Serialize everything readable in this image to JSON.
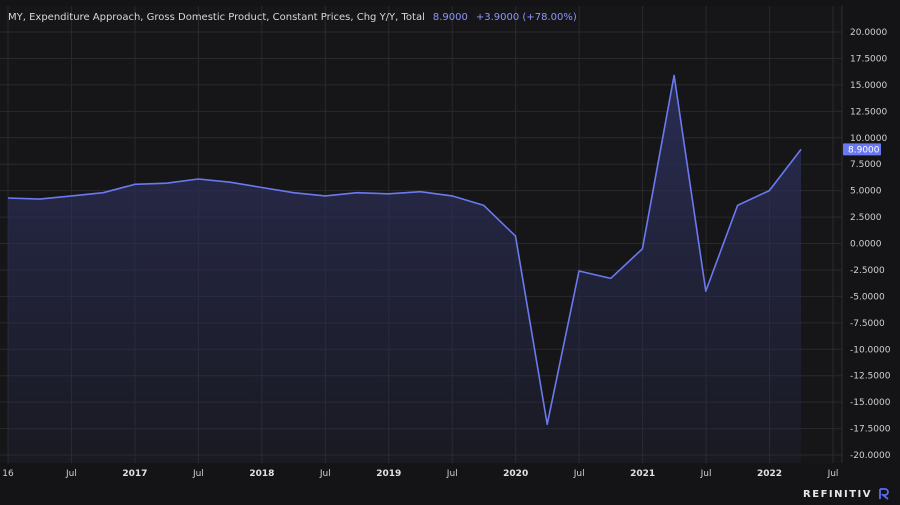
{
  "header": {
    "title": "MY, Expenditure Approach, Gross Domestic Product, Constant Prices, Chg Y/Y, Total",
    "last_value": "8.9000",
    "change": "+3.9000 (+78.00%)"
  },
  "brand": {
    "name": "REFINITIV"
  },
  "colors": {
    "line": "#6b79f0",
    "fill": "#2a2d55",
    "tag": "#6b79f0",
    "grid": "#2a2a2e"
  },
  "chart_data": {
    "type": "area",
    "title": "MY, Expenditure Approach, Gross Domestic Product, Constant Prices, Chg Y/Y, Total",
    "x": [
      "2016-04",
      "2016-07",
      "2016-10",
      "2017-01",
      "2017-04",
      "2017-07",
      "2017-10",
      "2018-01",
      "2018-04",
      "2018-07",
      "2018-10",
      "2019-01",
      "2019-04",
      "2019-07",
      "2019-10",
      "2020-01",
      "2020-04",
      "2020-07",
      "2020-10",
      "2021-01",
      "2021-04",
      "2021-07",
      "2021-10",
      "2022-01",
      "2022-04"
    ],
    "series": [
      {
        "values": [
          4.3,
          4.2,
          4.5,
          4.8,
          5.6,
          5.7,
          6.1,
          5.8,
          5.3,
          4.8,
          4.5,
          4.8,
          4.7,
          4.9,
          4.5,
          3.6,
          0.7,
          -17.1,
          -2.6,
          -3.3,
          -0.5,
          15.9,
          -4.5,
          3.6,
          5.0,
          8.9
        ]
      }
    ],
    "last_label": "8.9000",
    "ylim": [
      -20,
      22
    ],
    "yticks": [
      "20.0000",
      "17.5000",
      "15.0000",
      "12.5000",
      "10.0000",
      "7.5000",
      "5.0000",
      "2.5000",
      "0.0000",
      "-2.5000",
      "-5.0000",
      "-7.5000",
      "-10.0000",
      "-12.5000",
      "-15.0000",
      "-17.5000",
      "-20.0000"
    ],
    "xticks": [
      {
        "label": "16",
        "date": "2016-01",
        "year": false
      },
      {
        "label": "Jul",
        "date": "2016-07",
        "year": false
      },
      {
        "label": "2017",
        "date": "2017-01",
        "year": true
      },
      {
        "label": "Jul",
        "date": "2017-07",
        "year": false
      },
      {
        "label": "2018",
        "date": "2018-01",
        "year": true
      },
      {
        "label": "Jul",
        "date": "2018-07",
        "year": false
      },
      {
        "label": "2019",
        "date": "2019-01",
        "year": true
      },
      {
        "label": "Jul",
        "date": "2019-07",
        "year": false
      },
      {
        "label": "2020",
        "date": "2020-01",
        "year": true
      },
      {
        "label": "Jul",
        "date": "2020-07",
        "year": false
      },
      {
        "label": "2021",
        "date": "2021-01",
        "year": true
      },
      {
        "label": "Jul",
        "date": "2021-07",
        "year": false
      },
      {
        "label": "2022",
        "date": "2022-01",
        "year": true
      },
      {
        "label": "Jul",
        "date": "2022-07",
        "year": false
      }
    ],
    "grid": true
  }
}
